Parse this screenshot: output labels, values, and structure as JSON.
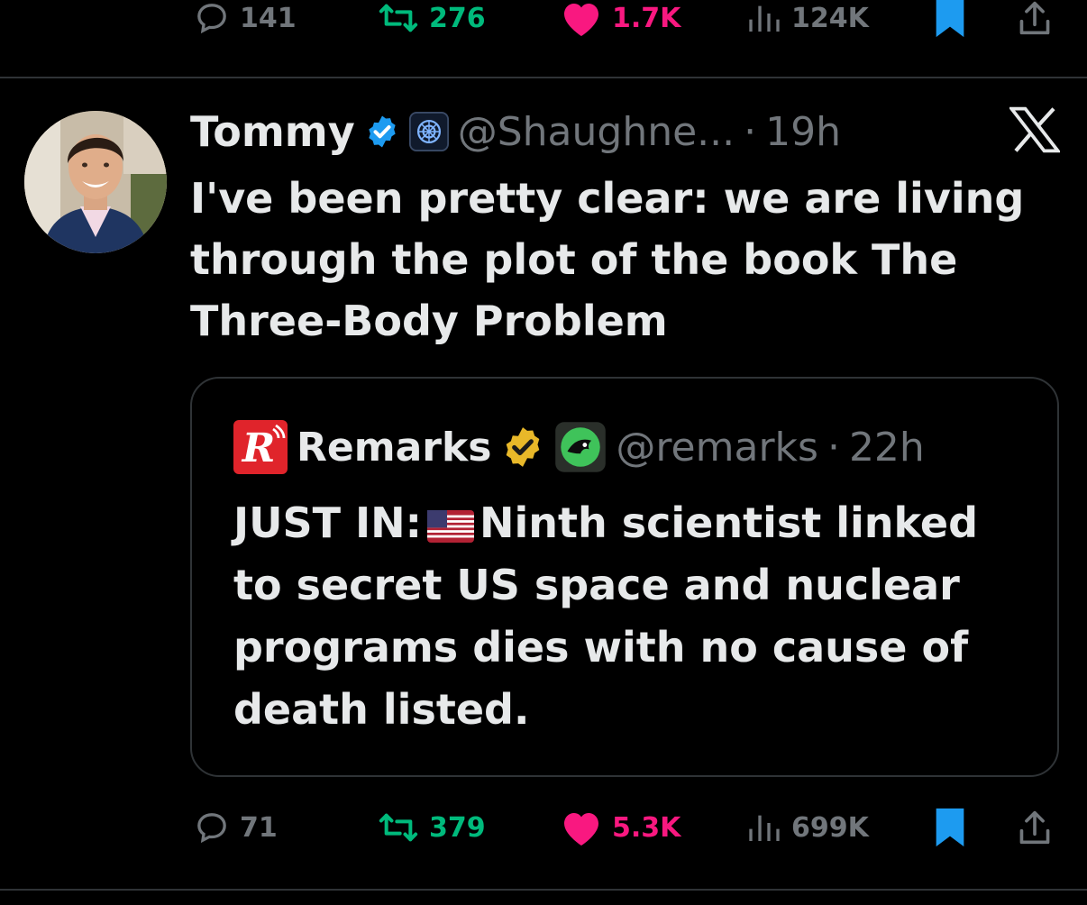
{
  "top_actions": {
    "replies": "141",
    "reposts": "276",
    "likes": "1.7K",
    "views": "124K"
  },
  "tweet": {
    "name": "Tommy",
    "handle": "@Shaughne...",
    "separator": "·",
    "time": "19h",
    "text": "I've been pretty clear: we are living through the plot of the book The Three-Body Problem",
    "quote": {
      "logo_letter": "R",
      "name": "Remarks",
      "handle": "@remarks",
      "separator": "·",
      "time": "22h",
      "text_prefix": "JUST IN:",
      "text_body": "Ninth scientist linked to secret US space and nuclear programs dies with no cause of death listed."
    },
    "actions": {
      "replies": "71",
      "reposts": "379",
      "likes": "5.3K",
      "views": "699K"
    }
  },
  "colors": {
    "background": "#000000",
    "text": "#e7e9ea",
    "secondary": "#71767b",
    "repost": "#00ba7c",
    "like": "#f91880",
    "bookmark": "#1d9bf0",
    "verified_blue": "#1d9bf0",
    "verified_gold": "#e8b829",
    "remarks_red": "#e0242b"
  },
  "icons": {
    "reply": "reply-icon",
    "repost": "repost-icon",
    "like": "heart-icon",
    "views": "views-icon",
    "bookmark": "bookmark-icon",
    "share": "share-icon",
    "x_logo": "x-logo-icon",
    "verified": "verified-badge-icon",
    "affiliate": "affiliate-badge-icon",
    "flag": "us-flag-icon"
  }
}
